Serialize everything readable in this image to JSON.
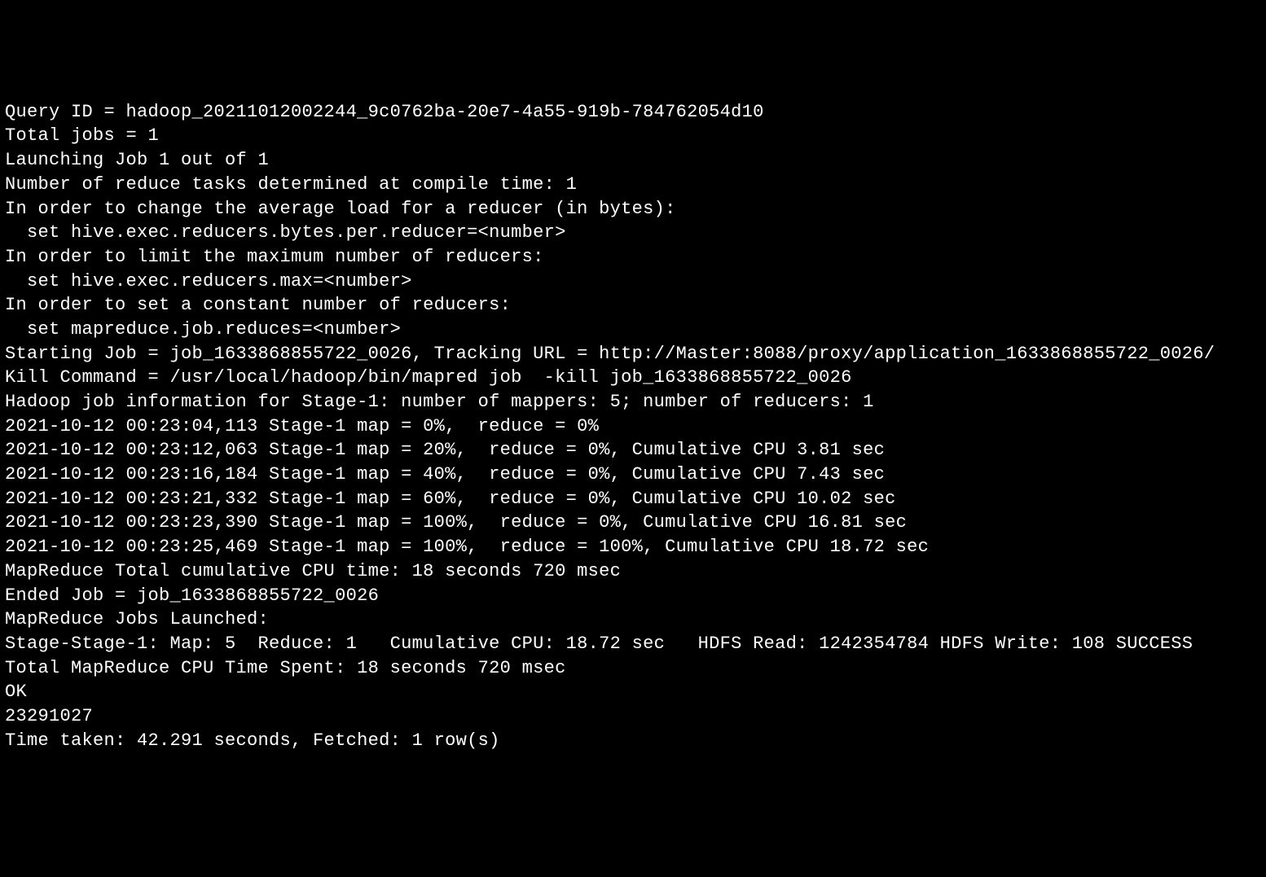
{
  "lines": [
    "Query ID = hadoop_20211012002244_9c0762ba-20e7-4a55-919b-784762054d10",
    "Total jobs = 1",
    "Launching Job 1 out of 1",
    "Number of reduce tasks determined at compile time: 1",
    "In order to change the average load for a reducer (in bytes):",
    "  set hive.exec.reducers.bytes.per.reducer=<number>",
    "In order to limit the maximum number of reducers:",
    "  set hive.exec.reducers.max=<number>",
    "In order to set a constant number of reducers:",
    "  set mapreduce.job.reduces=<number>",
    "Starting Job = job_1633868855722_0026, Tracking URL = http://Master:8088/proxy/application_1633868855722_0026/",
    "Kill Command = /usr/local/hadoop/bin/mapred job  -kill job_1633868855722_0026",
    "Hadoop job information for Stage-1: number of mappers: 5; number of reducers: 1",
    "2021-10-12 00:23:04,113 Stage-1 map = 0%,  reduce = 0%",
    "2021-10-12 00:23:12,063 Stage-1 map = 20%,  reduce = 0%, Cumulative CPU 3.81 sec",
    "2021-10-12 00:23:16,184 Stage-1 map = 40%,  reduce = 0%, Cumulative CPU 7.43 sec",
    "2021-10-12 00:23:21,332 Stage-1 map = 60%,  reduce = 0%, Cumulative CPU 10.02 sec",
    "2021-10-12 00:23:23,390 Stage-1 map = 100%,  reduce = 0%, Cumulative CPU 16.81 sec",
    "2021-10-12 00:23:25,469 Stage-1 map = 100%,  reduce = 100%, Cumulative CPU 18.72 sec",
    "MapReduce Total cumulative CPU time: 18 seconds 720 msec",
    "Ended Job = job_1633868855722_0026",
    "MapReduce Jobs Launched:",
    "Stage-Stage-1: Map: 5  Reduce: 1   Cumulative CPU: 18.72 sec   HDFS Read: 1242354784 HDFS Write: 108 SUCCESS",
    "Total MapReduce CPU Time Spent: 18 seconds 720 msec",
    "OK",
    "23291027",
    "Time taken: 42.291 seconds, Fetched: 1 row(s)"
  ]
}
